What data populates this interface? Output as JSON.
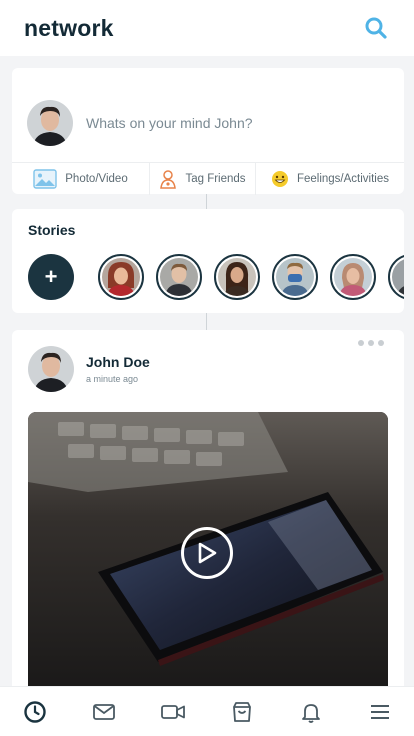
{
  "app": {
    "brand": "network",
    "accent": "#4fb3e6",
    "dark": "#1b3440"
  },
  "header": {
    "search_icon": "search-icon"
  },
  "composer": {
    "placeholder": "Whats on your mind John?",
    "actions": [
      {
        "label": "Photo/Video",
        "icon": "photo-icon"
      },
      {
        "label": "Tag Friends",
        "icon": "tag-friends-icon"
      },
      {
        "label": "Feelings/Activities",
        "icon": "smile-icon"
      }
    ]
  },
  "stories": {
    "title": "Stories",
    "add_label": "+",
    "items": [
      {
        "name": "story-1"
      },
      {
        "name": "story-2"
      },
      {
        "name": "story-3"
      },
      {
        "name": "story-4"
      },
      {
        "name": "story-5"
      },
      {
        "name": "story-6"
      }
    ]
  },
  "post": {
    "author": "John Doe",
    "time": "a minute ago"
  },
  "bottom_nav": [
    {
      "icon": "clock-icon",
      "active": true
    },
    {
      "icon": "mail-icon"
    },
    {
      "icon": "video-icon"
    },
    {
      "icon": "shopping-bag-icon"
    },
    {
      "icon": "bell-icon"
    },
    {
      "icon": "menu-icon"
    }
  ]
}
